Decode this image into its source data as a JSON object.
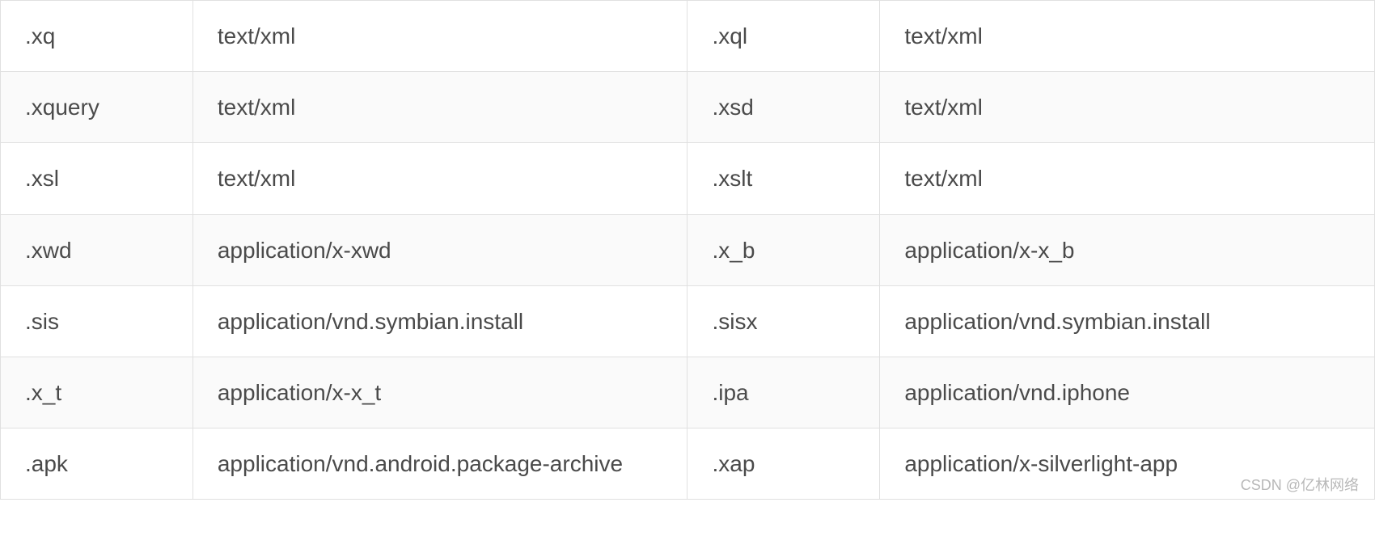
{
  "table": {
    "rows": [
      {
        "ext1": ".xq",
        "mime1": "text/xml",
        "ext2": ".xql",
        "mime2": "text/xml"
      },
      {
        "ext1": ".xquery",
        "mime1": "text/xml",
        "ext2": ".xsd",
        "mime2": "text/xml"
      },
      {
        "ext1": ".xsl",
        "mime1": "text/xml",
        "ext2": ".xslt",
        "mime2": "text/xml"
      },
      {
        "ext1": ".xwd",
        "mime1": "application/x-xwd",
        "ext2": ".x_b",
        "mime2": "application/x-x_b"
      },
      {
        "ext1": ".sis",
        "mime1": "application/vnd.symbian.install",
        "ext2": ".sisx",
        "mime2": "application/vnd.symbian.install"
      },
      {
        "ext1": ".x_t",
        "mime1": "application/x-x_t",
        "ext2": ".ipa",
        "mime2": "application/vnd.iphone"
      },
      {
        "ext1": ".apk",
        "mime1": "application/vnd.android.package-archive",
        "ext2": ".xap",
        "mime2": "application/x-silverlight-app"
      }
    ]
  },
  "watermark": "CSDN @亿林网络"
}
